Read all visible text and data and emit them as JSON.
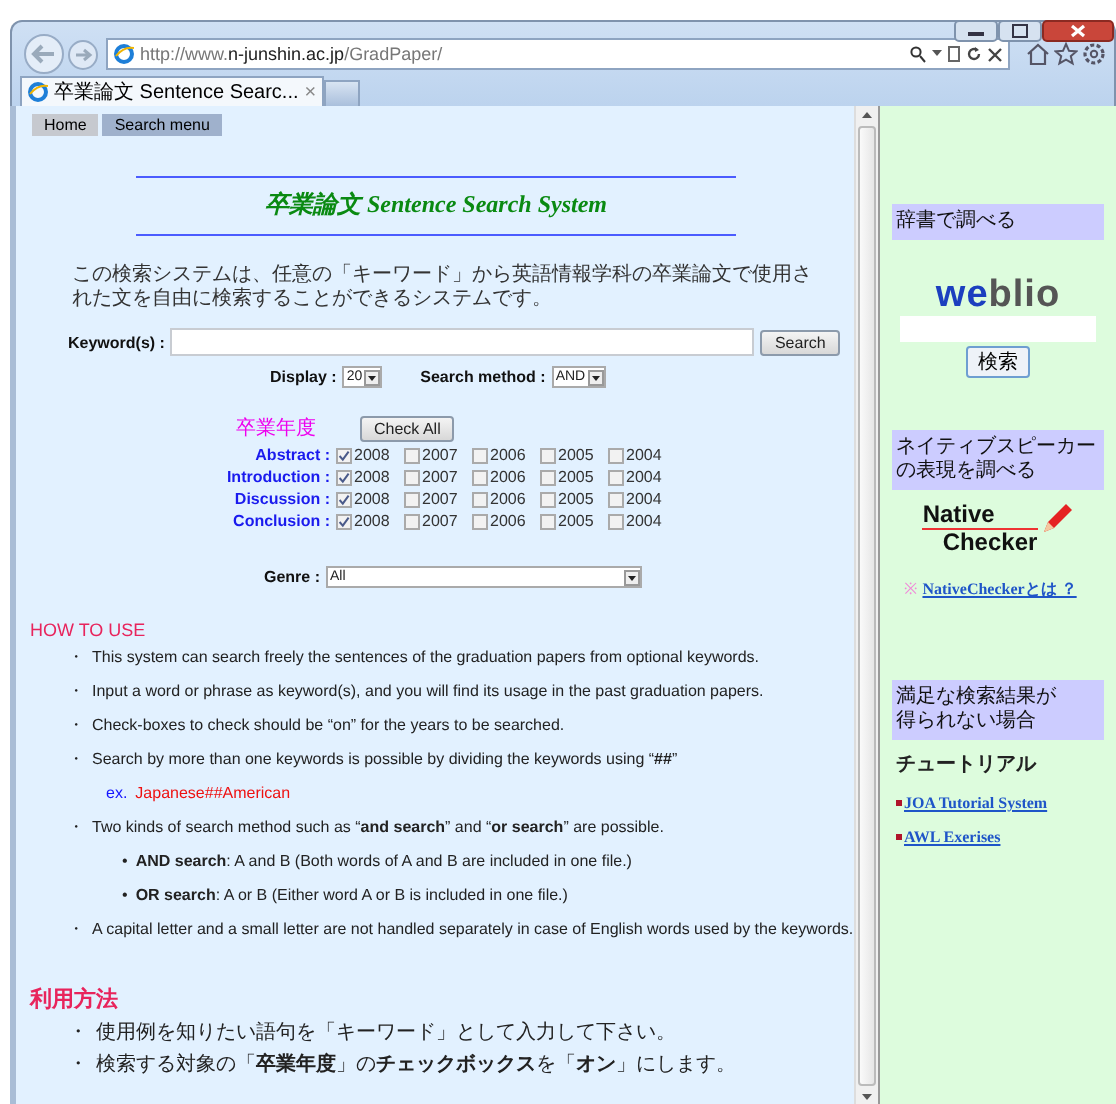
{
  "browser": {
    "url": "http://www.**n-junshin.ac.jp**/GradPaper/",
    "tab_title": "卒業論文 Sentence Searc...",
    "tab_close": "×"
  },
  "nav": [
    {
      "label": "Home",
      "selected": false
    },
    {
      "label": "Search menu",
      "selected": true
    }
  ],
  "title": "卒業論文 Sentence Search System",
  "intro": "この検索システムは、任意の「キーワード」から英語情報学科の卒業論文で使用された文を自由に検索することができるシステムです。",
  "keyword": {
    "label": "Keyword(s) :",
    "button": "Search"
  },
  "display": {
    "label": "Display :",
    "value": "20"
  },
  "method": {
    "label": "Search method :",
    "value": "AND"
  },
  "years": {
    "heading": "卒業年度",
    "button": "Check All",
    "rows": [
      {
        "label": "Abstract :",
        "boxes": [
          {
            "year": "2008",
            "checked": true
          },
          {
            "year": "2007",
            "checked": false
          },
          {
            "year": "2006",
            "checked": false
          },
          {
            "year": "2005",
            "checked": false
          },
          {
            "year": "2004",
            "checked": false
          }
        ]
      },
      {
        "label": "Introduction :",
        "boxes": [
          {
            "year": "2008",
            "checked": true
          },
          {
            "year": "2007",
            "checked": false
          },
          {
            "year": "2006",
            "checked": false
          },
          {
            "year": "2005",
            "checked": false
          },
          {
            "year": "2004",
            "checked": false
          }
        ]
      },
      {
        "label": "Discussion :",
        "boxes": [
          {
            "year": "2008",
            "checked": true
          },
          {
            "year": "2007",
            "checked": false
          },
          {
            "year": "2006",
            "checked": false
          },
          {
            "year": "2005",
            "checked": false
          },
          {
            "year": "2004",
            "checked": false
          }
        ]
      },
      {
        "label": "Conclusion :",
        "boxes": [
          {
            "year": "2008",
            "checked": true
          },
          {
            "year": "2007",
            "checked": false
          },
          {
            "year": "2006",
            "checked": false
          },
          {
            "year": "2005",
            "checked": false
          },
          {
            "year": "2004",
            "checked": false
          }
        ]
      }
    ]
  },
  "genre": {
    "label": "Genre :",
    "value": "All"
  },
  "how_to_use": {
    "heading": "HOW TO USE",
    "items": [
      {
        "kind": "bullet",
        "mark": "・",
        "text": "This system can search freely the sentences of the graduation papers from optional keywords."
      },
      {
        "kind": "bullet",
        "mark": "・",
        "text": "Input a word or phrase as keyword(s), and you will find its usage in the past graduation papers."
      },
      {
        "kind": "bullet",
        "mark": "・",
        "text": "Check-boxes to check should be “on” for the years to be searched."
      },
      {
        "kind": "bullet",
        "mark": "・",
        "text": "Search by more than one keywords is possible by dividing the keywords using “**##**”"
      },
      {
        "kind": "example",
        "mark": "ex.",
        "text": "Japanese##American"
      },
      {
        "kind": "bullet",
        "mark": "・",
        "text": "Two kinds of search method such as “**and search**” and “**or search**” are possible."
      },
      {
        "kind": "sub",
        "mark": "•",
        "text": "**AND search**: A and B (Both words of A and B are included in one file.)"
      },
      {
        "kind": "sub",
        "mark": "•",
        "text": "**OR search**: A or B (Either word A or B is included in one file.)"
      },
      {
        "kind": "bullet",
        "mark": "・",
        "text": "A capital letter and a small letter are not handled separately in case of English words used by the keywords."
      }
    ]
  },
  "riyou": {
    "heading": "利用方法",
    "items": [
      {
        "kind": "bullet",
        "mark": "・",
        "text": "使用例を知りたい語句を「キーワード」として入力して下さい。"
      },
      {
        "kind": "bullet",
        "mark": "・",
        "text": "検索する対象の「**卒業年度**」の**チェックボックス**を「**オン**」にします。"
      }
    ]
  },
  "side": {
    "dictionary": {
      "heading": "辞書で調べる",
      "logo_a": "we",
      "logo_b": "blio",
      "button": "検索"
    },
    "native": {
      "heading": [
        "ネイティブスピーカー",
        "の表現を調べる"
      ],
      "logo": [
        "Native",
        "Checker"
      ],
      "note_mark": "※",
      "link": "NativeCheckerとは ？"
    },
    "help": {
      "heading": [
        "満足な検索結果が",
        "得られない場合"
      ],
      "subheading": "チュートリアル",
      "links": [
        "JOA Tutorial System",
        "AWL Exerises"
      ]
    }
  }
}
